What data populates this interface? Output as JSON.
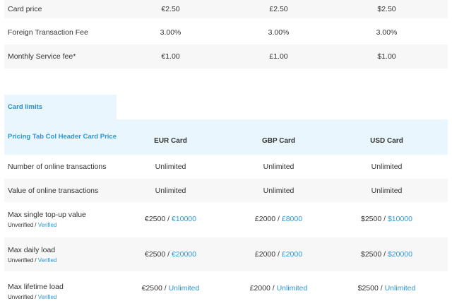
{
  "top_rows": [
    {
      "label": "Card price",
      "eur": "€2.50",
      "gbp": "£2.50",
      "usd": "$2.50"
    },
    {
      "label": "Foreign Transaction Fee",
      "eur": "3.00%",
      "gbp": "3.00%",
      "usd": "3.00%"
    },
    {
      "label": "Monthly Service fee*",
      "eur": "€1.00",
      "gbp": "£1.00",
      "usd": "$1.00"
    }
  ],
  "tab_label": "Card limits",
  "header": {
    "col_label": "Pricing Tab Col Header Card Price",
    "eur": "EUR Card",
    "gbp": "GBP Card",
    "usd": "USD Card"
  },
  "simple_rows": [
    {
      "label": "Number of online transactions",
      "eur": "Unlimited",
      "gbp": "Unlimited",
      "usd": "Unlimited"
    },
    {
      "label": "Value of online transactions",
      "eur": "Unlimited",
      "gbp": "Unlimited",
      "usd": "Unlimited"
    }
  ],
  "split_rows": [
    {
      "label": "Max single top-up value",
      "sub_unverified": "Unverified",
      "sub_sep": " / ",
      "sub_verified": "Verified",
      "eur": {
        "a": "€2500",
        "sep": " / ",
        "b": "€10000"
      },
      "gbp": {
        "a": "£2000",
        "sep": " / ",
        "b": "£8000"
      },
      "usd": {
        "a": "$2500",
        "sep": " / ",
        "b": "$10000"
      }
    },
    {
      "label": "Max daily load",
      "sub_unverified": "Unverified",
      "sub_sep": " / ",
      "sub_verified": "Verified",
      "eur": {
        "a": "€2500",
        "sep": " / ",
        "b": "€20000"
      },
      "gbp": {
        "a": "£2000",
        "sep": " / ",
        "b": "£2000"
      },
      "usd": {
        "a": "$2500",
        "sep": " / ",
        "b": "$20000"
      }
    },
    {
      "label": "Max lifetime load",
      "sub_unverified": "Unverified",
      "sub_sep": " / ",
      "sub_verified": "Verified",
      "eur": {
        "a": "€2500",
        "sep": " / ",
        "b": "Unlimited"
      },
      "gbp": {
        "a": "£2000",
        "sep": " / ",
        "b": "Unlimited"
      },
      "usd": {
        "a": "$2500",
        "sep": " / ",
        "b": "Unlimited"
      }
    }
  ],
  "colors": {
    "accent": "#2b97d6",
    "header_bg": "#e9f6fd",
    "alt_row": "#f7f7f7"
  }
}
